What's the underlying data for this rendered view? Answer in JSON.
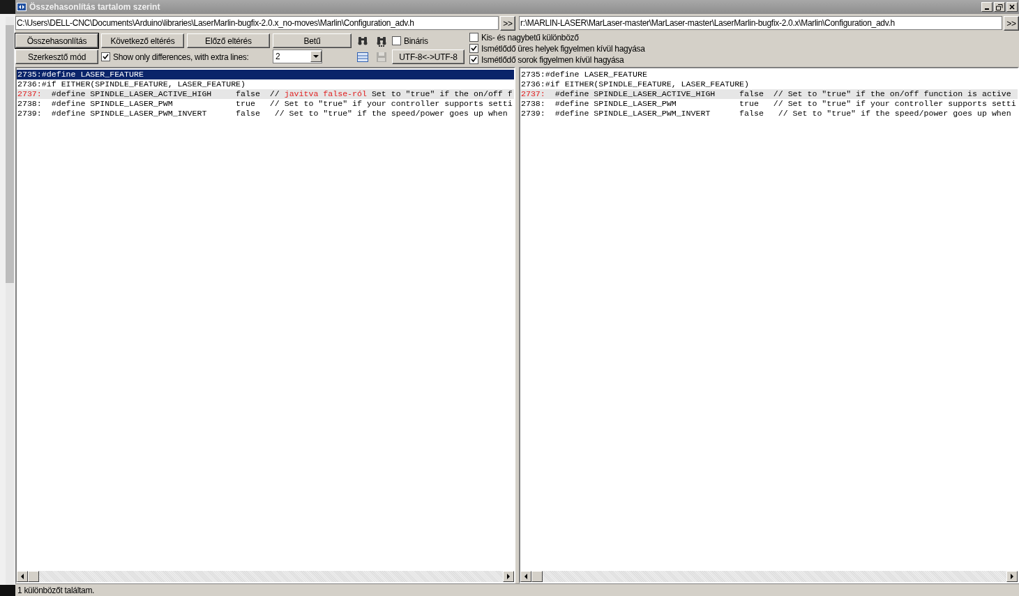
{
  "window": {
    "title": "Összehasonlítás tartalom szerint"
  },
  "paths": [
    {
      "value": "C:\\Users\\DELL-CNC\\Documents\\Arduino\\libraries\\LaserMarlin-bugfix-2.0.x_no-moves\\Marlin\\Configuration_adv.h",
      "button": ">>"
    },
    {
      "value": "r:\\MARLIN-LASER\\MarLaser-master\\MarLaser-master\\LaserMarlin-bugfix-2.0.x\\Marlin\\Configuration_adv.h",
      "button": ">>"
    }
  ],
  "toolbar": {
    "compare_button": "Összehasonlítás",
    "next_button": "Következő eltérés",
    "prev_button": "Előző eltérés",
    "font_button": "Betű",
    "binary": {
      "label": "Bináris",
      "checked": false
    },
    "editor_button": "Szerkesztő mód",
    "show_only_differences": {
      "label": "Show only differences, with extra lines:",
      "checked": true
    },
    "extra_lines": "2",
    "save_disabled": true,
    "encoding_button": "UTF-8<->UTF-8"
  },
  "options": [
    {
      "label": "Kis- és nagybetű különböző",
      "checked": false
    },
    {
      "label": "Ismétlődő üres helyek figyelmen kívül hagyása",
      "checked": true
    },
    {
      "label": "Ismétlődő sorok figyelmen kívül hagyása",
      "checked": true
    }
  ],
  "panes": [
    {
      "lines": [
        {
          "number": "2735:",
          "parts": [
            {
              "text": "#define LASER_FEATURE",
              "inserted": false
            }
          ],
          "selected": true,
          "changed": false
        },
        {
          "number": "2736:",
          "parts": [
            {
              "text": "#if EITHER(SPINDLE_FEATURE, LASER_FEATURE)",
              "inserted": false
            }
          ],
          "selected": false,
          "changed": false
        },
        {
          "number": "2737:",
          "parts": [
            {
              "text": "  #define SPINDLE_LASER_ACTIVE_HIGH     false  // ",
              "inserted": false
            },
            {
              "text": "javitva false-ról",
              "inserted": true
            },
            {
              "text": " Set to \"true\" if the on/off f",
              "inserted": false
            }
          ],
          "selected": false,
          "changed": true
        },
        {
          "number": "2738:",
          "parts": [
            {
              "text": "  #define SPINDLE_LASER_PWM             true   // Set to \"true\" if your controller supports setti",
              "inserted": false
            }
          ],
          "selected": false,
          "changed": false
        },
        {
          "number": "2739:",
          "parts": [
            {
              "text": "  #define SPINDLE_LASER_PWM_INVERT      false   // Set to \"true\" if the speed/power goes up when",
              "inserted": false
            }
          ],
          "selected": false,
          "changed": false
        }
      ]
    },
    {
      "lines": [
        {
          "number": "2735:",
          "parts": [
            {
              "text": "#define LASER_FEATURE",
              "inserted": false
            }
          ],
          "selected": false,
          "changed": false
        },
        {
          "number": "2736:",
          "parts": [
            {
              "text": "#if EITHER(SPINDLE_FEATURE, LASER_FEATURE)",
              "inserted": false
            }
          ],
          "selected": false,
          "changed": false
        },
        {
          "number": "2737:",
          "parts": [
            {
              "text": "  #define SPINDLE_LASER_ACTIVE_HIGH     false  // Set to \"true\" if the on/off function is active",
              "inserted": false
            }
          ],
          "selected": false,
          "changed": true
        },
        {
          "number": "2738:",
          "parts": [
            {
              "text": "  #define SPINDLE_LASER_PWM             true   // Set to \"true\" if your controller supports setti",
              "inserted": false
            }
          ],
          "selected": false,
          "changed": false
        },
        {
          "number": "2739:",
          "parts": [
            {
              "text": "  #define SPINDLE_LASER_PWM_INVERT      false   // Set to \"true\" if the speed/power goes up when",
              "inserted": false
            }
          ],
          "selected": false,
          "changed": false
        }
      ]
    }
  ],
  "status_bar": "1 különbözőt találtam."
}
